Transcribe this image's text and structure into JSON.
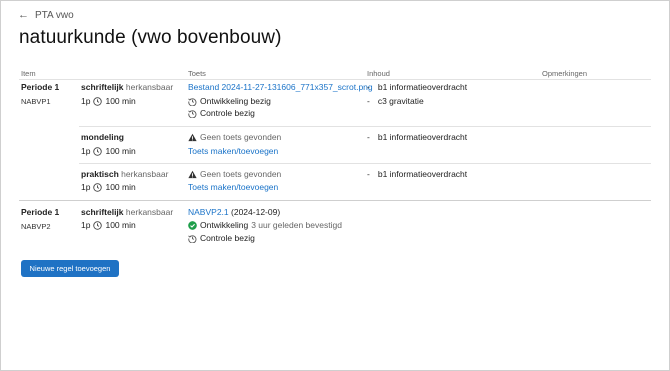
{
  "nav": {
    "back_label": "PTA vwo"
  },
  "title": "natuurkunde (vwo bovenbouw)",
  "columns": {
    "item": "Item",
    "toets": "Toets",
    "inhoud": "Inhoud",
    "opmerkingen": "Opmerkingen"
  },
  "groups": [
    {
      "period": "Periode 1",
      "code": "NABVP1",
      "rows": [
        {
          "type": "schriftelijk",
          "resit": "herkansbaar",
          "weight": "1p",
          "duration": "100 min",
          "toets_link": "Bestand 2024-11-27-131606_771x357_scrot.png",
          "status1": "Ontwikkeling bezig",
          "status2": "Controle bezig",
          "inhoud": [
            "b1 informatieoverdracht",
            "c3 gravitatie"
          ]
        },
        {
          "type": "mondeling",
          "weight": "1p",
          "duration": "100 min",
          "warning": "Geen toets gevonden",
          "action": "Toets maken/toevoegen",
          "inhoud": [
            "b1 informatieoverdracht"
          ]
        },
        {
          "type": "praktisch",
          "resit": "herkansbaar",
          "weight": "1p",
          "duration": "100 min",
          "warning": "Geen toets gevonden",
          "action": "Toets maken/toevoegen",
          "inhoud": [
            "b1 informatieoverdracht"
          ]
        }
      ]
    },
    {
      "period": "Periode 1",
      "code": "NABVP2",
      "rows": [
        {
          "type": "schriftelijk",
          "resit": "herkansbaar",
          "weight": "1p",
          "duration": "100 min",
          "toets_link": "NABVP2.1",
          "toets_date": "(2024-12-09)",
          "status1": "Ontwikkeling",
          "status1_extra": "3 uur geleden bevestigd",
          "status2": "Controle bezig"
        }
      ]
    }
  ],
  "add_button": "Nieuwe regel toevoegen",
  "colors": {
    "link": "#1a73c8",
    "button": "#1f72c4",
    "check": "#1e9e4a"
  },
  "icons": [
    "arrow-left-icon",
    "clock-icon",
    "history-icon",
    "warning-icon",
    "check-circle-icon"
  ]
}
